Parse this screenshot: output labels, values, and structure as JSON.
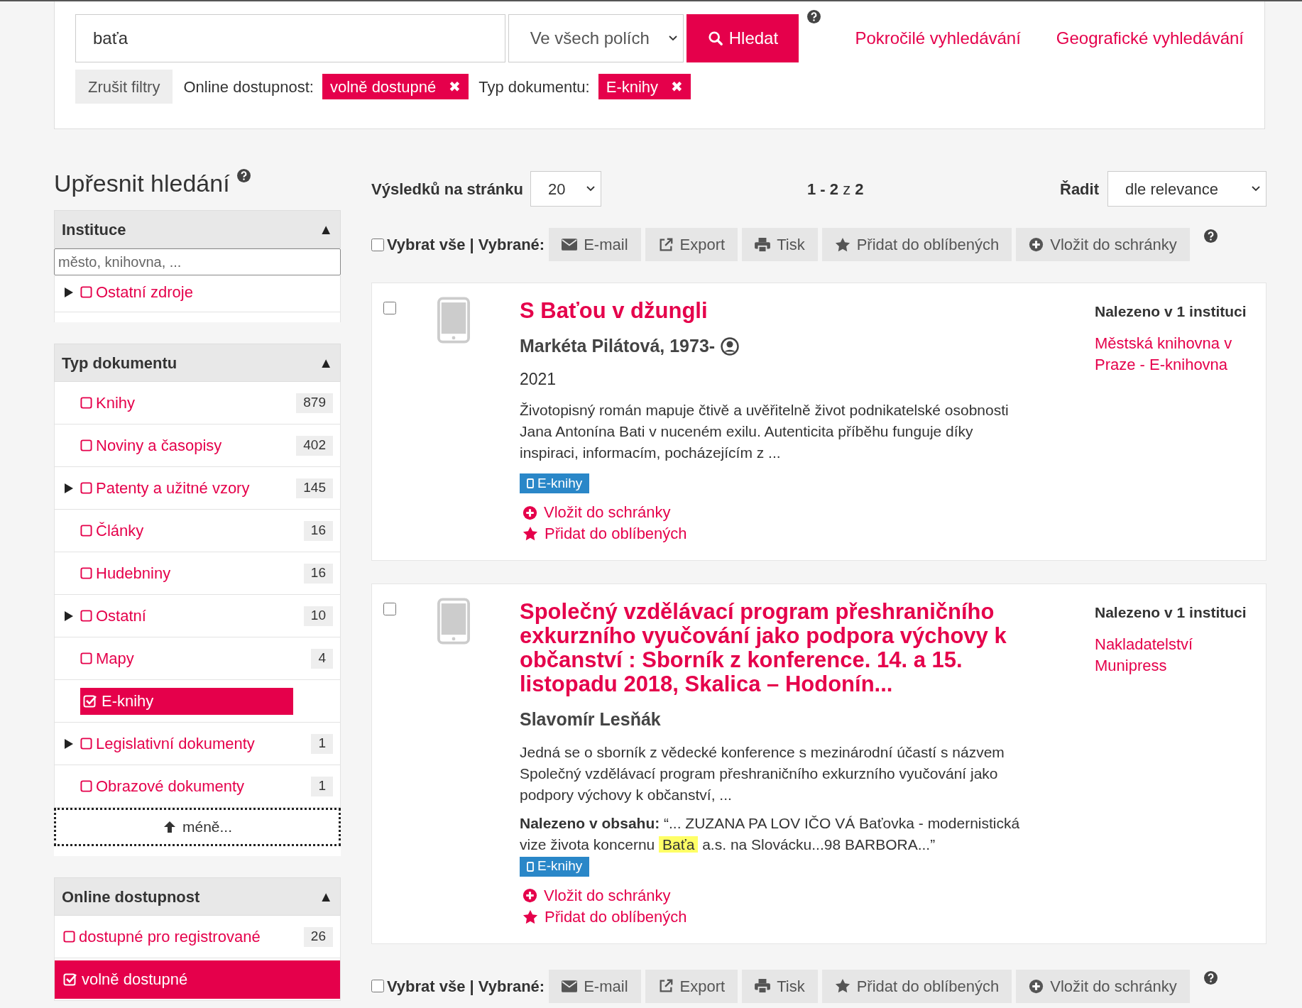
{
  "search": {
    "value": "baťa",
    "field_select": "Ve všech polích",
    "button": "Hledat",
    "links": [
      "Pokročilé vyhledávání",
      "Geografické vyhledávání"
    ]
  },
  "filters": {
    "clear": "Zrušit filtry",
    "active": [
      {
        "label": "Online dostupnost:",
        "value": "volně dostupné",
        "remove": "✖"
      },
      {
        "label": "Typ dokumentu:",
        "value": "E-knihy",
        "remove": "✖"
      }
    ]
  },
  "sidebar": {
    "title": "Upřesnit hledání",
    "panels": [
      {
        "title": "Instituce",
        "toggle": "▲",
        "placeholder": "město, knihovna, ...",
        "items": [
          {
            "label": "Ostatní zdroje",
            "expandable": true,
            "checked": false
          }
        ]
      },
      {
        "title": "Typ dokumentu",
        "toggle": "▲",
        "items": [
          {
            "label": "Knihy",
            "count": "879",
            "expandable": false,
            "checked": false
          },
          {
            "label": "Noviny a časopisy",
            "count": "402",
            "expandable": false,
            "checked": false
          },
          {
            "label": "Patenty a užitné vzory",
            "count": "145",
            "expandable": true,
            "checked": false
          },
          {
            "label": "Články",
            "count": "16",
            "expandable": false,
            "checked": false
          },
          {
            "label": "Hudebniny",
            "count": "16",
            "expandable": false,
            "checked": false
          },
          {
            "label": "Ostatní",
            "count": "10",
            "expandable": true,
            "checked": false
          },
          {
            "label": "Mapy",
            "count": "4",
            "expandable": false,
            "checked": false
          },
          {
            "label": "E-knihy",
            "expandable": false,
            "checked": true
          },
          {
            "label": "Legislativní dokumenty",
            "count": "1",
            "expandable": true,
            "checked": false
          },
          {
            "label": "Obrazové dokumenty",
            "count": "1",
            "expandable": false,
            "checked": false
          }
        ],
        "less": "méně..."
      },
      {
        "title": "Online dostupnost",
        "toggle": "▲",
        "flat": true,
        "items": [
          {
            "label": "dostupné pro registrované",
            "count": "26",
            "checked": false
          },
          {
            "label": "volně dostupné",
            "checked": true
          }
        ]
      }
    ]
  },
  "results_bar": {
    "per_page_label": "Výsledků na stránku",
    "per_page": "20",
    "range": "1 - 2",
    "range_of": "z",
    "total": "2",
    "sort_label": "Řadit",
    "sort": "dle relevance"
  },
  "toolbar_top": {
    "select_all": "Vybrat vše | Vybrané:",
    "checked": false,
    "buttons": [
      {
        "kind": "email",
        "label": "E-mail"
      },
      {
        "kind": "export",
        "label": "Export"
      },
      {
        "kind": "print",
        "label": "Tisk"
      },
      {
        "kind": "favorite",
        "label": "Přidat do oblíbených"
      },
      {
        "kind": "basket",
        "label": "Vložit do schránky"
      }
    ]
  },
  "results": [
    {
      "checked": false,
      "title": "S Baťou v džungli",
      "author": "Markéta Pilátová, 1973-",
      "author_icon": true,
      "year": "2021",
      "description": "Životopisný román mapuje čtivě a uvěřitelně život podnikatelské osobnosti Jana Antonína Bati v nuceném exilu. Autenticita příběhu funguje díky inspiraci, informacím, pocházejícím z ...",
      "badge": "E-knihy",
      "actions": [
        {
          "kind": "basket",
          "label": "Vložit do schránky"
        },
        {
          "kind": "favorite",
          "label": "Přidat do oblíbených"
        }
      ],
      "found_in": "Nalezeno v 1 instituci",
      "institution": "Městská knihovna v Praze - E-knihovna"
    },
    {
      "checked": false,
      "title": "Společný vzdělávací program přeshraničního exkurzního vyučování jako podpora výchovy k občanství : Sborník z konference. 14. a 15. listopadu 2018, Skalica – Hodonín...",
      "author": "Slavomír Lesňák",
      "author_icon": false,
      "description": "Jedná se o sborník z vědecké konference s mezinárodní účastí s názvem Společný vzdělávací program přeshraničního exkurzního vyučování jako podpory výchovy k občanství, ...",
      "content_match": {
        "label": "Nalezeno v obsahu:",
        "before": "“... ZUZANA PA LOV IČO VÁ Baťovka - modernistická vize života koncernu",
        "highlight": "Baťa",
        "after": "a.s. na Slovácku...98 BARBORA...”"
      },
      "badge": "E-knihy",
      "actions": [
        {
          "kind": "basket",
          "label": "Vložit do schránky"
        },
        {
          "kind": "favorite",
          "label": "Přidat do oblíbených"
        }
      ],
      "found_in": "Nalezeno v 1 instituci",
      "institution": "Nakladatelství Munipress"
    }
  ],
  "toolbar_bottom": {
    "select_all": "Vybrat vše | Vybrané:",
    "checked": false,
    "buttons": [
      {
        "kind": "email",
        "label": "E-mail"
      },
      {
        "kind": "export",
        "label": "Export"
      },
      {
        "kind": "print",
        "label": "Tisk"
      },
      {
        "kind": "favorite",
        "label": "Přidat do oblíbených"
      },
      {
        "kind": "basket",
        "label": "Vložit do schránky"
      }
    ]
  }
}
